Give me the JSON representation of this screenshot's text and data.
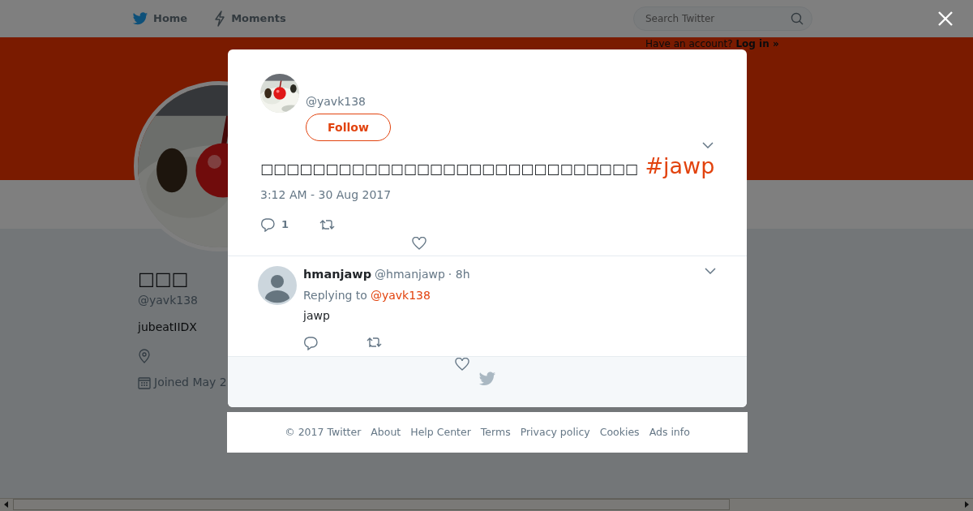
{
  "topbar": {
    "nav": [
      {
        "label": "Home"
      },
      {
        "label": "Moments"
      }
    ],
    "search": {
      "placeholder": "Search Twitter"
    },
    "login_prompt": {
      "text": "Have an account?",
      "link": "Log in »"
    }
  },
  "profile": {
    "name": "□□□",
    "handle": "@yavk138",
    "bio": "jubeatIIDX",
    "joined": "Joined May 2"
  },
  "modal": {
    "tweet": {
      "handle": "@yavk138",
      "follow": "Follow",
      "text": "□□□□□□□□□□□□□□□□□□□□□□□□□□□□□",
      "hashtag": "#jawp",
      "timestamp": "3:12 AM - 30 Aug 2017",
      "reply_count": "1"
    },
    "replies": [
      {
        "name": "hmanjawp",
        "handle": "@hmanjawp",
        "time": "· 8h",
        "replying_label": "Replying to",
        "replying_to": "@yavk138",
        "text": "jawp"
      }
    ]
  },
  "footer": {
    "links": [
      "© 2017 Twitter",
      "About",
      "Help Center",
      "Terms",
      "Privacy policy",
      "Cookies",
      "Ads info"
    ]
  }
}
